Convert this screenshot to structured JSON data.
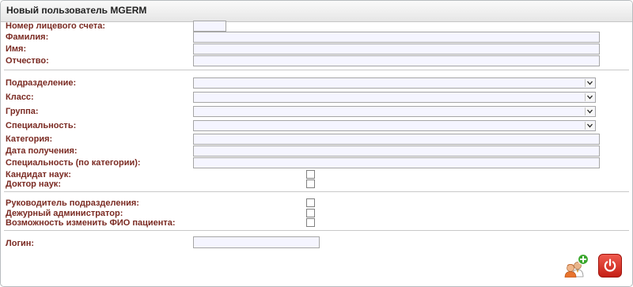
{
  "window": {
    "title": "Новый пользователь MGERM"
  },
  "fields": {
    "account_number": {
      "label": "Номер лицевого счета:",
      "value": ""
    },
    "last_name": {
      "label": "Фамилия:",
      "value": ""
    },
    "first_name": {
      "label": "Имя:",
      "value": ""
    },
    "patronymic": {
      "label": "Отчество:",
      "value": ""
    },
    "department": {
      "label": "Подразделение:",
      "value": ""
    },
    "class": {
      "label": "Класс:",
      "value": ""
    },
    "group": {
      "label": "Группа:",
      "value": ""
    },
    "specialty": {
      "label": "Специальность:",
      "value": ""
    },
    "category": {
      "label": "Категория:",
      "value": ""
    },
    "received_date": {
      "label": "Дата получения:",
      "value": ""
    },
    "category_specialty": {
      "label": "Специальность (по категории):",
      "value": ""
    },
    "candidate_of_sciences": {
      "label": "Кандидат наук:",
      "checked": false
    },
    "doctor_of_sciences": {
      "label": "Доктор наук:",
      "checked": false
    },
    "department_head": {
      "label": "Руководитель подразделения:",
      "checked": false
    },
    "duty_admin": {
      "label": "Дежурный администратор:",
      "checked": false
    },
    "can_edit_patient_name": {
      "label": "Возможность изменить ФИО пациента:",
      "checked": false
    },
    "login": {
      "label": "Логин:",
      "value": ""
    }
  },
  "actions": {
    "add_user_icon": "add-user-icon",
    "power_icon": "power-icon"
  },
  "colors": {
    "label": "#7a2a22",
    "input_bg": "#f5f5ff",
    "power_button": "#d9281d",
    "add_badge": "#3aa72d"
  }
}
